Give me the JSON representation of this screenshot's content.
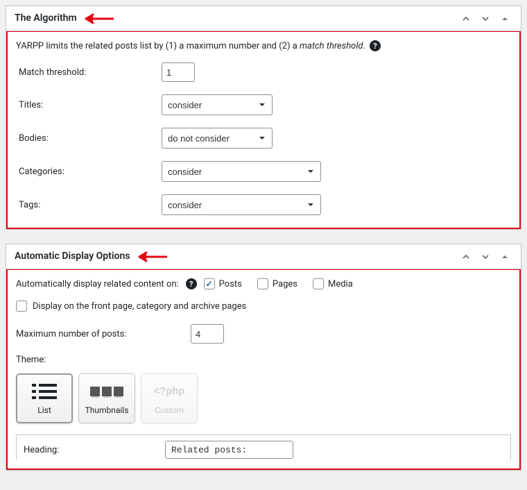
{
  "sections": {
    "algorithm": {
      "title": "The Algorithm",
      "intro_pre": "YARPP limits the related posts list by (1) a maximum number and (2) a ",
      "intro_em": "match threshold",
      "intro_post": ".",
      "fields": {
        "match_threshold": {
          "label": "Match threshold:",
          "value": "1"
        },
        "titles": {
          "label": "Titles:",
          "value": "consider"
        },
        "bodies": {
          "label": "Bodies:",
          "value": "do not consider"
        },
        "categories": {
          "label": "Categories:",
          "value": "consider"
        },
        "tags": {
          "label": "Tags:",
          "value": "consider"
        }
      }
    },
    "auto_display": {
      "title": "Automatic Display Options",
      "auto_display_label": "Automatically display related content on:",
      "checkboxes": {
        "posts": {
          "label": "Posts",
          "checked": true
        },
        "pages": {
          "label": "Pages",
          "checked": false
        },
        "media": {
          "label": "Media",
          "checked": false
        }
      },
      "front_page": {
        "label": "Display on the front page, category and archive pages",
        "checked": false
      },
      "max_posts": {
        "label": "Maximum number of posts:",
        "value": "4"
      },
      "theme_label": "Theme:",
      "themes": {
        "list": "List",
        "thumbnails": "Thumbnails",
        "custom": "Custom"
      },
      "heading": {
        "label": "Heading:",
        "value": "Related posts:"
      }
    }
  },
  "annotation": {
    "arrow_color": "#e30613"
  }
}
